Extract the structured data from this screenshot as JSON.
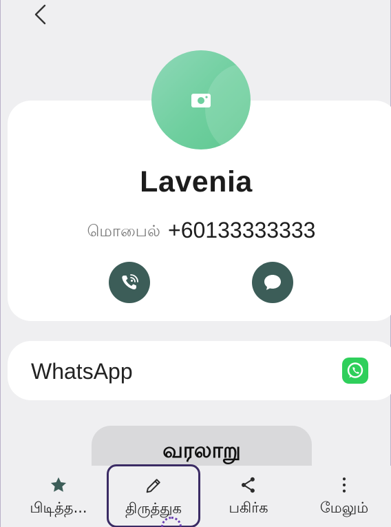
{
  "header": {
    "back_icon": "chevron-left-icon"
  },
  "contact": {
    "avatar_icon": "camera-icon",
    "name": "Lavenia",
    "phone_label": "மொபைல்",
    "phone_number": "+60133333333"
  },
  "actions": {
    "call_icon": "wifi-call-icon",
    "message_icon": "message-bubble-icon"
  },
  "linked_app": {
    "label": "WhatsApp",
    "icon": "whatsapp-icon"
  },
  "history_button": "வரலாறு",
  "bottom_nav": {
    "favourite": {
      "label": "பிடித்த...",
      "icon": "star-icon"
    },
    "edit": {
      "label": "திருத்துக",
      "icon": "pencil-icon"
    },
    "share": {
      "label": "பகிர்க",
      "icon": "share-icon"
    },
    "more": {
      "label": "மேலும்",
      "icon": "more-vertical-icon"
    }
  },
  "colors": {
    "accent": "#3c5d58",
    "avatar": "#6fcf9f",
    "whatsapp": "#2fcf5b",
    "highlight": "#3a2b64"
  }
}
